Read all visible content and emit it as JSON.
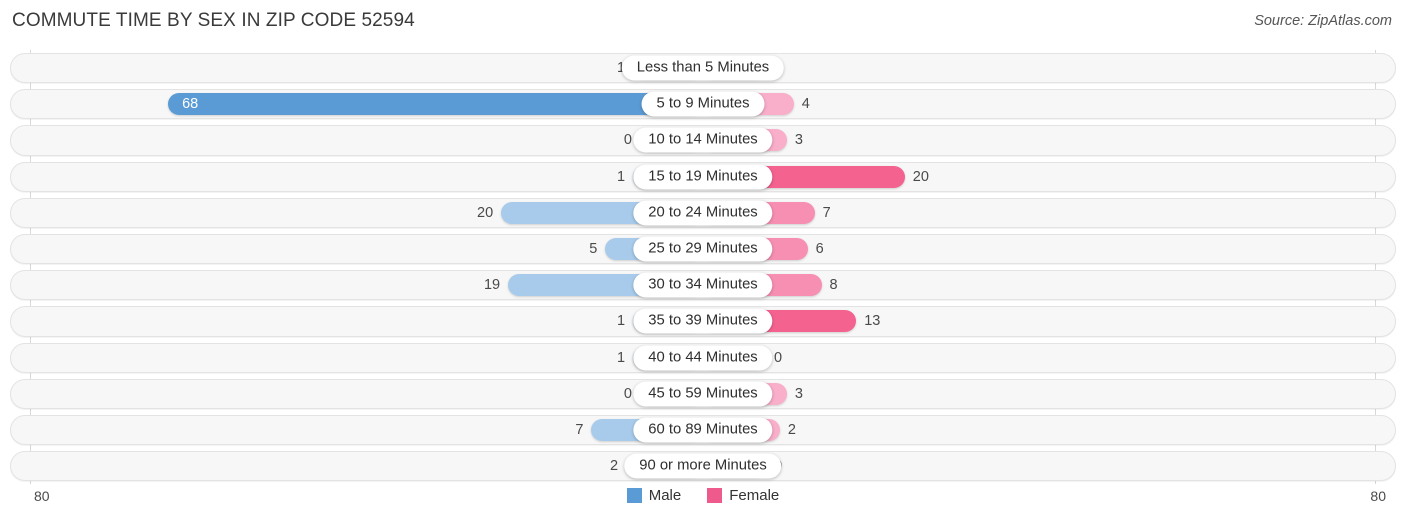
{
  "header": {
    "title": "COMMUTE TIME BY SEX IN ZIP CODE 52594",
    "source": "Source: ZipAtlas.com"
  },
  "axis": {
    "left_label": "80",
    "right_label": "80",
    "max": 80
  },
  "legend": [
    {
      "label": "Male",
      "color": "#5B9BD5"
    },
    {
      "label": "Female",
      "color": "#EF5A8C"
    }
  ],
  "colors": {
    "male_light": "#A8CBEC",
    "male_strong": "#5B9BD5",
    "female_light": "#F9AECA",
    "female_mid": "#F78FB3",
    "female_strong": "#F4628F",
    "track": "#F7F7F7",
    "track_border": "#E3E3E3",
    "gridline": "#D8D8D8"
  },
  "chart_data": {
    "type": "bar",
    "subtype": "diverging-bidirectional",
    "title": "COMMUTE TIME BY SEX IN ZIP CODE 52594",
    "xlabel": "",
    "ylabel": "",
    "xlim": [
      80,
      80
    ],
    "grid": true,
    "legend_position": "bottom-center",
    "categories": [
      "Less than 5 Minutes",
      "5 to 9 Minutes",
      "10 to 14 Minutes",
      "15 to 19 Minutes",
      "20 to 24 Minutes",
      "25 to 29 Minutes",
      "30 to 34 Minutes",
      "35 to 39 Minutes",
      "40 to 44 Minutes",
      "45 to 59 Minutes",
      "60 to 89 Minutes",
      "90 or more Minutes"
    ],
    "series": [
      {
        "name": "Male",
        "values": [
          1,
          68,
          0,
          1,
          20,
          5,
          19,
          1,
          1,
          0,
          7,
          2
        ]
      },
      {
        "name": "Female",
        "values": [
          0,
          4,
          3,
          20,
          7,
          6,
          8,
          13,
          0,
          3,
          2,
          0
        ]
      }
    ]
  },
  "rows": [
    {
      "category": "Less than 5 Minutes",
      "male": "1",
      "female": "0"
    },
    {
      "category": "5 to 9 Minutes",
      "male": "68",
      "female": "4"
    },
    {
      "category": "10 to 14 Minutes",
      "male": "0",
      "female": "3"
    },
    {
      "category": "15 to 19 Minutes",
      "male": "1",
      "female": "20"
    },
    {
      "category": "20 to 24 Minutes",
      "male": "20",
      "female": "7"
    },
    {
      "category": "25 to 29 Minutes",
      "male": "5",
      "female": "6"
    },
    {
      "category": "30 to 34 Minutes",
      "male": "19",
      "female": "8"
    },
    {
      "category": "35 to 39 Minutes",
      "male": "1",
      "female": "13"
    },
    {
      "category": "40 to 44 Minutes",
      "male": "1",
      "female": "0"
    },
    {
      "category": "45 to 59 Minutes",
      "male": "0",
      "female": "3"
    },
    {
      "category": "60 to 89 Minutes",
      "male": "7",
      "female": "2"
    },
    {
      "category": "90 or more Minutes",
      "male": "2",
      "female": "0"
    }
  ]
}
